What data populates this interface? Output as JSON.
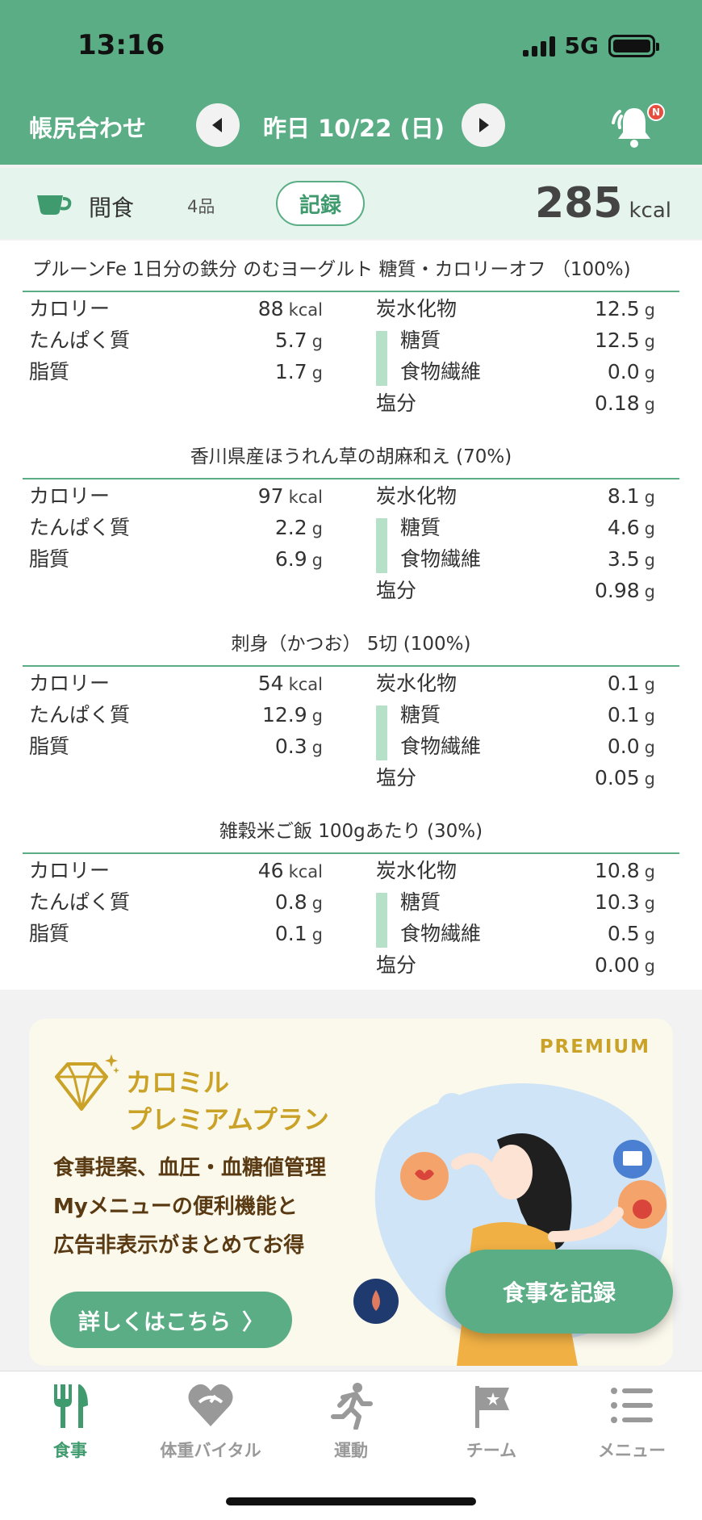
{
  "status": {
    "time": "13:16",
    "network": "5G"
  },
  "header": {
    "left_title": "帳尻合わせ",
    "date": "昨日 10/22 (日)",
    "notification_badge": "N"
  },
  "meal": {
    "name": "間食",
    "count": "4品",
    "record_label": "記録",
    "total_value": "285",
    "total_unit": "kcal"
  },
  "labels": {
    "calorie": "カロリー",
    "protein": "たんぱく質",
    "fat": "脂質",
    "carb": "炭水化物",
    "sugar": "糖質",
    "fiber": "食物繊維",
    "salt": "塩分",
    "kcal": "kcal",
    "g": "g"
  },
  "foods": [
    {
      "title": "プルーンFe 1日分の鉄分 のむヨーグルト 糖質・カロリーオフ （100%)",
      "calorie": "88",
      "protein": "5.7",
      "fat": "1.7",
      "carb": "12.5",
      "sugar": "12.5",
      "fiber": "0.0",
      "salt": "0.18"
    },
    {
      "title": "香川県産ほうれん草の胡麻和え (70%)",
      "calorie": "97",
      "protein": "2.2",
      "fat": "6.9",
      "carb": "8.1",
      "sugar": "4.6",
      "fiber": "3.5",
      "salt": "0.98"
    },
    {
      "title": "刺身（かつお） 5切 (100%)",
      "calorie": "54",
      "protein": "12.9",
      "fat": "0.3",
      "carb": "0.1",
      "sugar": "0.1",
      "fiber": "0.0",
      "salt": "0.05"
    },
    {
      "title": "雑穀米ご飯 100gあたり (30%)",
      "calorie": "46",
      "protein": "0.8",
      "fat": "0.1",
      "carb": "10.8",
      "sugar": "10.3",
      "fiber": "0.5",
      "salt": "0.00"
    }
  ],
  "premium": {
    "tag": "PREMIUM",
    "title_line1": "カロミル",
    "title_line2": "プレミアムプラン",
    "line1": "食事提案、血圧・血糖値管理",
    "line2": "Myメニューの便利機能と",
    "line3": "広告非表示がまとめてお得",
    "details_button": "詳しくはこちら",
    "details_chevron": "〉"
  },
  "fab_label": "食事を記録",
  "tabs": [
    {
      "label": "食事",
      "icon": "fork-knife-icon"
    },
    {
      "label": "体重バイタル",
      "icon": "heart-scale-icon"
    },
    {
      "label": "運動",
      "icon": "runner-icon"
    },
    {
      "label": "チーム",
      "icon": "flag-icon"
    },
    {
      "label": "メニュー",
      "icon": "menu-list-icon"
    }
  ],
  "colors": {
    "brand": "#5aad84",
    "gold": "#c9a227",
    "badge": "#e84d3d"
  }
}
